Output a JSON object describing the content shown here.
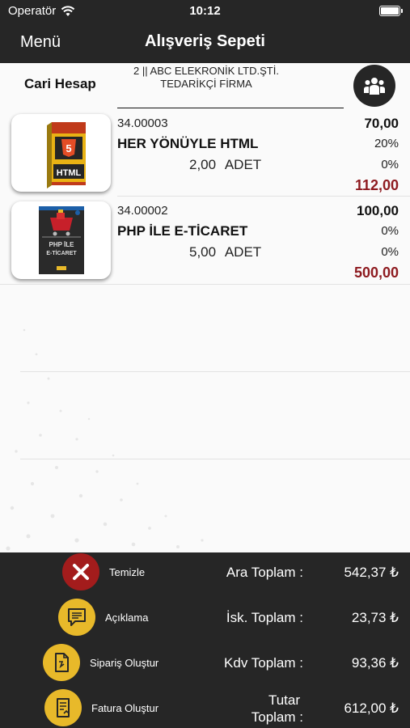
{
  "status_bar": {
    "carrier": "Operatör",
    "time": "10:12",
    "battery_level": 1.0
  },
  "nav": {
    "menu_label": "Menü",
    "title": "Alışveriş Sepeti"
  },
  "account": {
    "label": "Cari Hesap",
    "name_line1": "2 || ABC ELEKRONİK LTD.ŞTİ.",
    "name_line2": "TEDARİKÇİ FİRMA",
    "icon": "users-group-icon"
  },
  "items": [
    {
      "code": "34.00003",
      "name": "HER YÖNÜYLE HTML",
      "quantity": "2,00",
      "unit": "ADET",
      "price": "70,00",
      "discount1": "20%",
      "discount2": "0%",
      "total": "112,00",
      "image_icon": "html-book-cover"
    },
    {
      "code": "34.00002",
      "name": "PHP İLE E-TİCARET",
      "quantity": "5,00",
      "unit": "ADET",
      "price": "100,00",
      "discount1": "0%",
      "discount2": "0%",
      "total": "500,00",
      "image_icon": "php-book-cover"
    }
  ],
  "actions": {
    "clear": {
      "label": "Temizle",
      "icon": "close-icon",
      "color": "#a31c1c"
    },
    "note": {
      "label": "Açıklama",
      "icon": "comment-icon",
      "color": "#e8b92a"
    },
    "order": {
      "label": "Sipariş Oluştur",
      "icon": "order-document-icon",
      "color": "#e8b92a"
    },
    "invoice": {
      "label": "Fatura Oluştur",
      "icon": "invoice-icon",
      "color": "#e8b92a"
    }
  },
  "totals": {
    "subtotal_label": "Ara Toplam :",
    "subtotal_value": "542,37 ₺",
    "discount_label": "İsk. Toplam :",
    "discount_value": "23,73 ₺",
    "vat_label": "Kdv Toplam :",
    "vat_value": "93,36 ₺",
    "grand_label_line1": "Tutar",
    "grand_label_line2": "Toplam :",
    "grand_value": "612,00 ₺"
  }
}
